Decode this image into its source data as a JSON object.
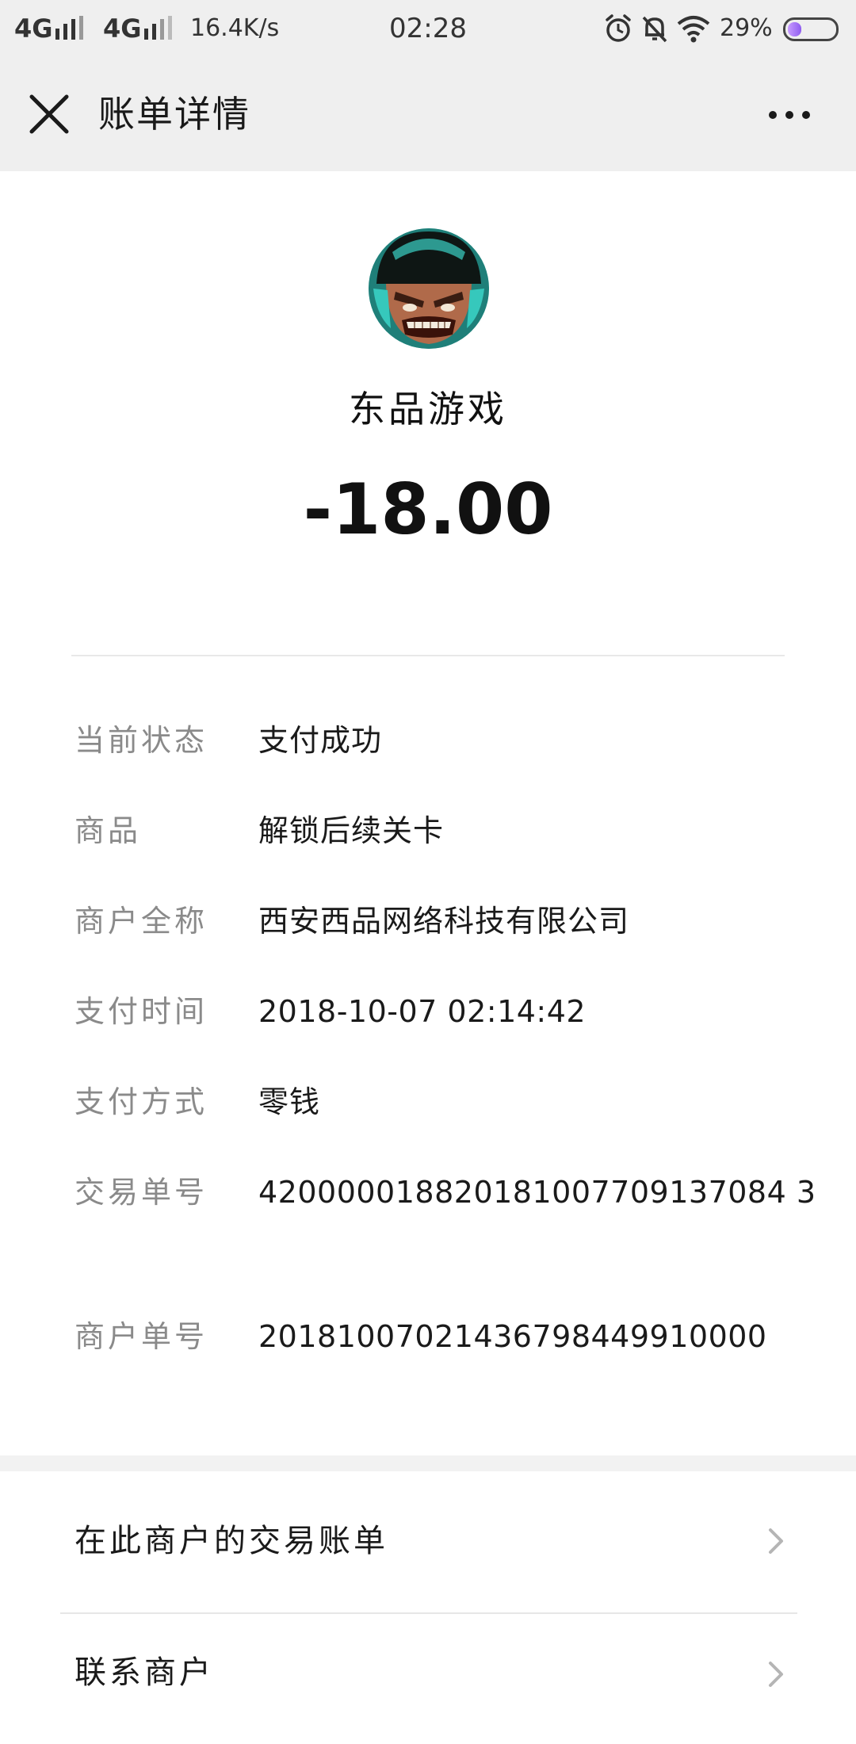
{
  "status_bar": {
    "network_1": "4G",
    "network_2": "4G",
    "speed": "16.4K/s",
    "time": "02:28",
    "battery_percent": "29%",
    "battery_level": 0.29,
    "icons": [
      "signal-icon",
      "alarm-icon",
      "mute-bell-icon",
      "wifi-icon",
      "battery-icon"
    ]
  },
  "nav": {
    "title": "账单详情",
    "close_icon": "close-icon",
    "more_icon": "more-icon"
  },
  "header": {
    "merchant_name": "东品游戏",
    "amount": "-18.00"
  },
  "details": [
    {
      "label": "当前状态",
      "value": "支付成功"
    },
    {
      "label": "商品",
      "value": "解锁后续关卡"
    },
    {
      "label": "商户全称",
      "value": "西安西品网络科技有限公司"
    },
    {
      "label": "支付时间",
      "value": "2018-10-07 02:14:42"
    },
    {
      "label": "支付方式",
      "value": "零钱"
    },
    {
      "label": "交易单号",
      "value": "420000018820181007709137084 3"
    },
    {
      "label": "商户单号",
      "value": "20181007021436798449910000"
    }
  ],
  "actions": [
    {
      "label": "在此商户的交易账单"
    },
    {
      "label": "联系商户"
    }
  ],
  "colors": {
    "bar_background": "#efefef",
    "label_gray": "#8a8a8a",
    "text_dark": "#1a1a1a"
  }
}
